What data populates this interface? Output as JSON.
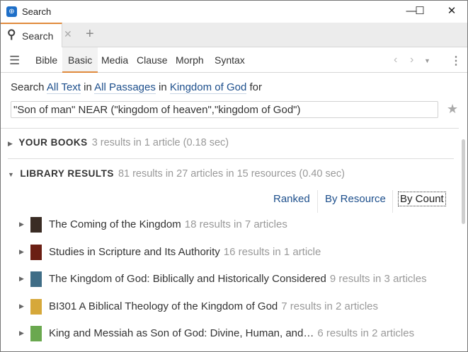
{
  "window": {
    "title": "Search",
    "controls": [
      "—",
      "☐",
      "✕"
    ]
  },
  "tabs": [
    {
      "label": "Search",
      "icon": "search-icon"
    }
  ],
  "toolbar": {
    "tabs": [
      "Bible",
      "Basic",
      "Media",
      "Clause",
      "Morph",
      "Syntax"
    ],
    "active": "Basic"
  },
  "scope": {
    "w1": "Search",
    "text_scope": "All Text",
    "w2": "in",
    "passages": "All Passages",
    "w3": "in",
    "collection": "Kingdom of God",
    "w4": "for"
  },
  "query": {
    "value": "\"Son of man\" NEAR (\"kingdom of heaven\",\"kingdom of God\")"
  },
  "your_books": {
    "label": "YOUR BOOKS",
    "meta": "3 results in 1 article (0.18 sec)"
  },
  "library": {
    "label": "LIBRARY RESULTS",
    "meta": "81 results in 27 articles in 15 resources (0.40 sec)"
  },
  "sort": {
    "ranked": "Ranked",
    "by_resource": "By Resource",
    "by_count": "By Count",
    "active": "By Count"
  },
  "results": [
    {
      "title": "The Coming of the Kingdom",
      "meta": "18 results in 7 articles",
      "color": "#3a2c24"
    },
    {
      "title": "Studies in Scripture and Its Authority",
      "meta": "16 results in 1 article",
      "color": "#6b1f14"
    },
    {
      "title": "The Kingdom of God: Biblically and Historically Considered",
      "meta": "9 results in 3 articles",
      "color": "#3f6d86"
    },
    {
      "title": "BI301 A Biblical Theology of the Kingdom of God",
      "meta": "7 results in 2 articles",
      "color": "#d6a83a"
    },
    {
      "title": "King and Messiah as Son of God: Divine, Human, and…",
      "meta": "6 results in 2 articles",
      "color": "#6aa84f"
    }
  ]
}
